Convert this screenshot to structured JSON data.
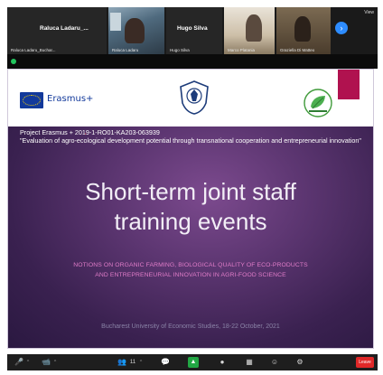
{
  "participants": [
    {
      "big_label": "Raluca Ladaru_...",
      "caption": "Raluca Ladaru_Buchar..."
    },
    {
      "big_label": "",
      "caption": "Raluca Ladaru"
    },
    {
      "big_label": "Hugo Silva",
      "caption": "Hugo Silva"
    },
    {
      "big_label": "",
      "caption": "Marco Platania"
    },
    {
      "big_label": "",
      "caption": "Graziella Di Matteo"
    }
  ],
  "strip": {
    "next_icon": "chevron-right-icon",
    "view_label": "View"
  },
  "slide": {
    "erasmus_text": "Erasmus+",
    "project_line": "Project Erasmus + 2019-1-RO01-KA203-063939",
    "quote_line": "\"Evaluation of agro-ecological development potential through transnational cooperation and entrepreneurial innovation\"",
    "headline_1": "Short-term joint staff",
    "headline_2": "training events",
    "subline_1": "NOTIONS ON ORGANIC FARMING, BIOLOGICAL QUALITY OF ECO-PRODUCTS",
    "subline_2": "AND ENTREPRENEURIAL INNOVATION IN AGRI-FOOD SCIENCE",
    "footer": "Bucharest University of Economic Studies, 18-22 October, 2021"
  },
  "toolbar": {
    "mic": "🎤",
    "video": "📹",
    "participants": "👥",
    "participants_count": "11",
    "chat": "💬",
    "share": "▲",
    "record": "●",
    "reactions": "☺",
    "apps": "▦",
    "more": "⚙",
    "leave": "Leave"
  },
  "colors": {
    "accent": "#2d8cff",
    "leave": "#e02828",
    "share": "#22a744",
    "slide_bg": "#5b3570",
    "subtitle": "#e07cc8"
  }
}
